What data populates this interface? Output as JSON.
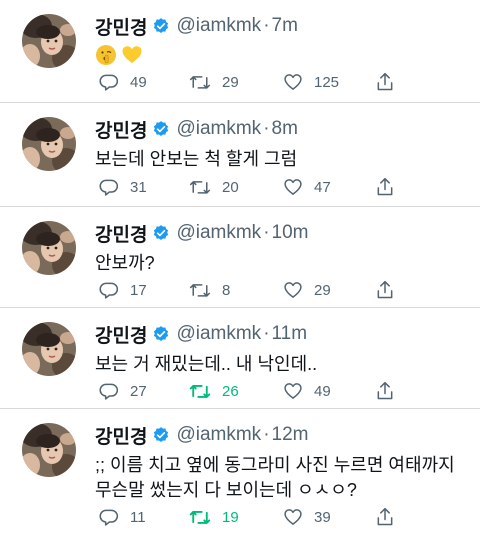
{
  "colors": {
    "retweeted": "#00ba7c",
    "verified": "#1d9bf0",
    "muted": "#536471"
  },
  "tweets": [
    {
      "name": "강민경",
      "handle": "@iamkmk",
      "sep": "·",
      "time": "7m",
      "text": "",
      "emoji": [
        "shushing-face",
        "yellow-heart"
      ],
      "replies": "49",
      "retweets": "29",
      "likes": "125",
      "retweeted": false
    },
    {
      "name": "강민경",
      "handle": "@iamkmk",
      "sep": "·",
      "time": "8m",
      "text": "보는데 안보는 척 할게 그럼",
      "replies": "31",
      "retweets": "20",
      "likes": "47",
      "retweeted": false
    },
    {
      "name": "강민경",
      "handle": "@iamkmk",
      "sep": "·",
      "time": "10m",
      "text": "안보까?",
      "replies": "17",
      "retweets": "8",
      "likes": "29",
      "retweeted": false
    },
    {
      "name": "강민경",
      "handle": "@iamkmk",
      "sep": "·",
      "time": "11m",
      "text": "보는 거 재밌는데.. 내 낙인데..",
      "replies": "27",
      "retweets": "26",
      "likes": "49",
      "retweeted": true
    },
    {
      "name": "강민경",
      "handle": "@iamkmk",
      "sep": "·",
      "time": "12m",
      "text_line1": ";; 이름 치고 옆에 동그라미 사진 누르면 여태까지",
      "text_line2": "무슨말 썼는지 다 보이는데 ㅇㅅㅇ?",
      "replies": "11",
      "retweets": "19",
      "likes": "39",
      "retweeted": true
    }
  ]
}
